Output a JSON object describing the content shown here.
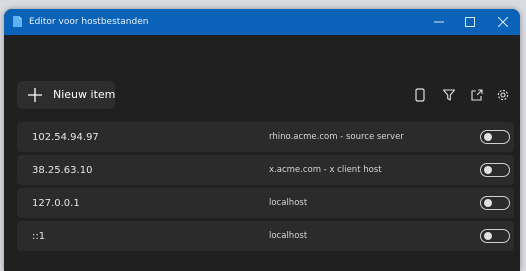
{
  "window": {
    "title": "Editor voor hostbestanden",
    "accent_color": "#0a63b8",
    "background_color": "#202020"
  },
  "controls": {
    "minimize_icon": "minimize-icon",
    "maximize_icon": "maximize-icon",
    "close_icon": "close-icon"
  },
  "toolbar": {
    "new_item_label": "Nieuw item",
    "icons": [
      "document-icon",
      "filter-icon",
      "open-external-icon",
      "gear-icon"
    ]
  },
  "entries": [
    {
      "address": "102.54.94.97",
      "host": "rhino.acme.com - source server",
      "enabled": false
    },
    {
      "address": "38.25.63.10",
      "host": "x.acme.com - x client host",
      "enabled": false
    },
    {
      "address": "127.0.0.1",
      "host": "localhost",
      "enabled": false
    },
    {
      "address": "::1",
      "host": "localhost",
      "enabled": false
    }
  ]
}
